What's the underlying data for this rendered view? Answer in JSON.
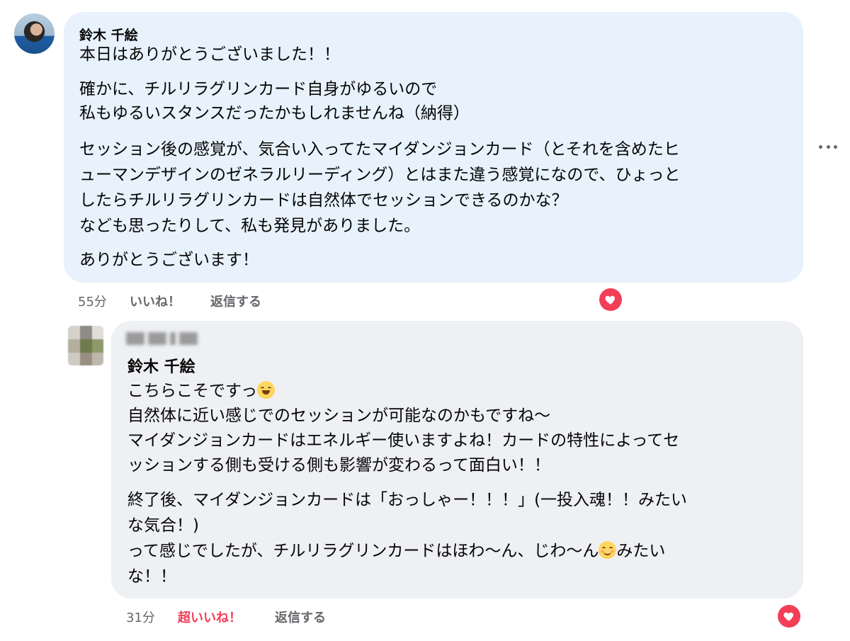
{
  "comment1": {
    "author": "鈴木 千絵",
    "lines": [
      "本日はありがとうございました！！",
      "確かに、チルリラグリンカード自身がゆるいので",
      "私もゆるいスタンスだったかもしれませんね（納得）",
      "セッション後の感覚が、気合い入ってたマイダンジョンカード（とそれを含めたヒ",
      "ューマンデザインのゼネラルリーディング）とはまた違う感覚になので、ひょっと",
      "したらチルリラグリンカードは自然体でセッションできるのかな？",
      "なども思ったりして、私も発見がありました。",
      "ありがとうございます！"
    ],
    "time": "55分",
    "like_label": "いいね！",
    "reply_label": "返信する",
    "reaction": "heart"
  },
  "comment2": {
    "author": "鈴木 千絵",
    "line1_text": "こちらこそですっ",
    "line1_emoji": "grinning-squinting-face",
    "lines": [
      "自然体に近い感じでのセッションが可能なのかもですね〜",
      "マイダンジョンカードはエネルギー使いますよね！カードの特性によってセ",
      "ッションする側も受ける側も影響が変わるって面白い！！",
      "終了後、マイダンジョンカードは「おっしゃー！！！」(一投入魂！！みたい",
      "な気合！)"
    ],
    "line_last_a": "って感じでしたが、チルリラグリンカードはほわ〜ん、じわ〜ん",
    "line_last_emoji": "relieved-face",
    "line_last_b": "みたい",
    "line_final": "な！！",
    "time": "31分",
    "like_label": "超いいね！",
    "reply_label": "返信する",
    "reaction": "heart"
  },
  "colors": {
    "bubble_own": "#e7f2fc",
    "bubble_reply": "#eef0f3",
    "meta": "#65676b",
    "love": "#f33e58"
  }
}
